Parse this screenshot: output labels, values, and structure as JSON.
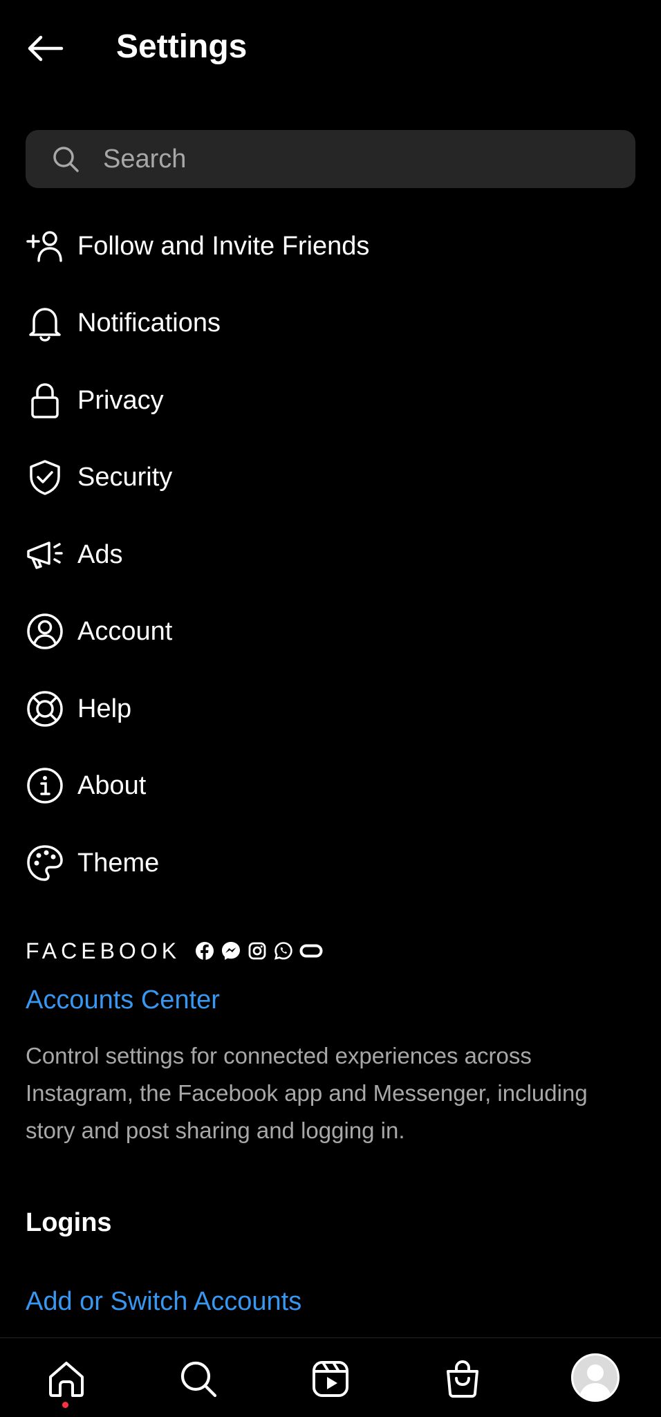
{
  "header": {
    "title": "Settings",
    "back_icon": "arrow-left-icon"
  },
  "search": {
    "placeholder": "Search",
    "value": ""
  },
  "menu": {
    "items": [
      {
        "label": "Follow and Invite Friends",
        "icon": "add-person-icon"
      },
      {
        "label": "Notifications",
        "icon": "bell-icon"
      },
      {
        "label": "Privacy",
        "icon": "lock-icon"
      },
      {
        "label": "Security",
        "icon": "shield-check-icon"
      },
      {
        "label": "Ads",
        "icon": "megaphone-icon"
      },
      {
        "label": "Account",
        "icon": "account-circle-icon"
      },
      {
        "label": "Help",
        "icon": "lifebuoy-icon"
      },
      {
        "label": "About",
        "icon": "info-icon"
      },
      {
        "label": "Theme",
        "icon": "palette-icon"
      }
    ]
  },
  "facebook": {
    "wordmark": "FACEBOOK",
    "app_icons": [
      "facebook-icon",
      "messenger-icon",
      "instagram-icon",
      "whatsapp-icon",
      "oculus-icon"
    ]
  },
  "accounts_center": {
    "link": "Accounts Center",
    "description": "Control settings for connected experiences across Instagram, the Facebook app and Messenger, including story and post sharing and logging in."
  },
  "logins": {
    "heading": "Logins",
    "add_switch": "Add or Switch Accounts"
  },
  "bottom_nav": {
    "items": [
      "home-icon",
      "search-icon",
      "reels-icon",
      "shop-icon",
      "profile-avatar"
    ]
  },
  "colors": {
    "background": "#000000",
    "link": "#3897f0",
    "secondary_text": "#a8a8a8",
    "search_bg": "#262626",
    "notification_dot": "#ff3040"
  }
}
